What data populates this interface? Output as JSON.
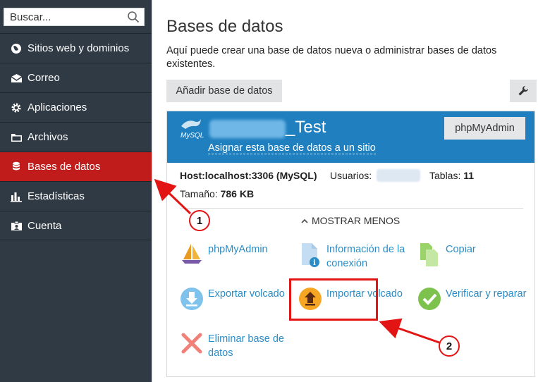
{
  "sidebar": {
    "search": {
      "placeholder": "Buscar...",
      "icon": "search-icon"
    },
    "items": [
      {
        "label": "Sitios web y dominios",
        "icon": "globe-icon",
        "active": false
      },
      {
        "label": "Correo",
        "icon": "envelope-icon",
        "active": false
      },
      {
        "label": "Aplicaciones",
        "icon": "gear-icon",
        "active": false
      },
      {
        "label": "Archivos",
        "icon": "folder-icon",
        "active": false
      },
      {
        "label": "Bases de datos",
        "icon": "database-icon",
        "active": true
      },
      {
        "label": "Estadísticas",
        "icon": "bar-chart-icon",
        "active": false
      },
      {
        "label": "Cuenta",
        "icon": "id-card-icon",
        "active": false
      }
    ]
  },
  "main": {
    "title": "Bases de datos",
    "description": "Aquí puede crear una base de datos nueva o administrar bases de datos existentes.",
    "add_button": "Añadir base de datos",
    "tools_icon": "wrench-icon"
  },
  "database": {
    "logo_text": "MySQL",
    "name_suffix": "_Test",
    "assign_link": "Asignar esta base de datos a un sitio",
    "phpmyadmin_button": "phpMyAdmin",
    "host_label": "Host:",
    "host_value": "localhost:3306 (MySQL)",
    "users_label": "Usuarios:",
    "tables_label": "Tablas:",
    "tables_value": "11",
    "size_label": "Tamaño:",
    "size_value": "786 KB",
    "toggle_label": "MOSTRAR MENOS",
    "actions": [
      {
        "label": "phpMyAdmin",
        "icon": "sailboat-icon"
      },
      {
        "label": "Información de la conexión",
        "icon": "connection-info-icon"
      },
      {
        "label": "Copiar",
        "icon": "copy-icon"
      },
      {
        "label": "Exportar volcado",
        "icon": "export-download-icon"
      },
      {
        "label": "Importar volcado",
        "icon": "import-upload-icon"
      },
      {
        "label": "Verificar y reparar",
        "icon": "check-icon"
      },
      {
        "label": "Eliminar base de datos",
        "icon": "delete-x-icon"
      }
    ]
  },
  "annotations": {
    "callout_1": "1",
    "callout_2": "2",
    "color": "#e31414"
  },
  "colors": {
    "sidebar_bg": "#303a44",
    "active_item": "#c01c1c",
    "header_blue": "#1f7fbf",
    "link_blue": "#2a8dc7"
  }
}
